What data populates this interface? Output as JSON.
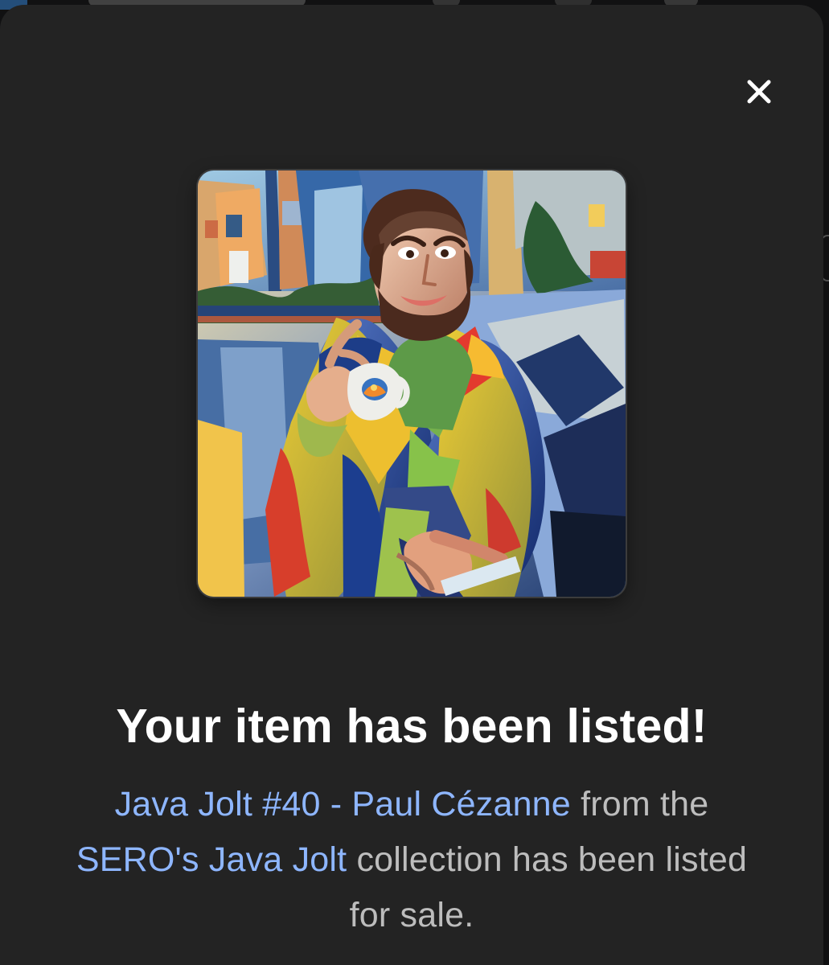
{
  "modal": {
    "close_icon": "close-icon",
    "artwork": {
      "alt": "Java Jolt #40 - Paul Cézanne"
    },
    "title": "Your item has been listed!",
    "message": {
      "item_link": "Java Jolt #40 - Paul Cézanne",
      "from_text": " from the ",
      "collection_link": "SERO's Java Jolt",
      "tail_text": " collection has been listed for sale."
    },
    "colors": {
      "background": "#232323",
      "title": "#ffffff",
      "body": "#bdbdbd",
      "link": "#8eb6ff"
    }
  }
}
